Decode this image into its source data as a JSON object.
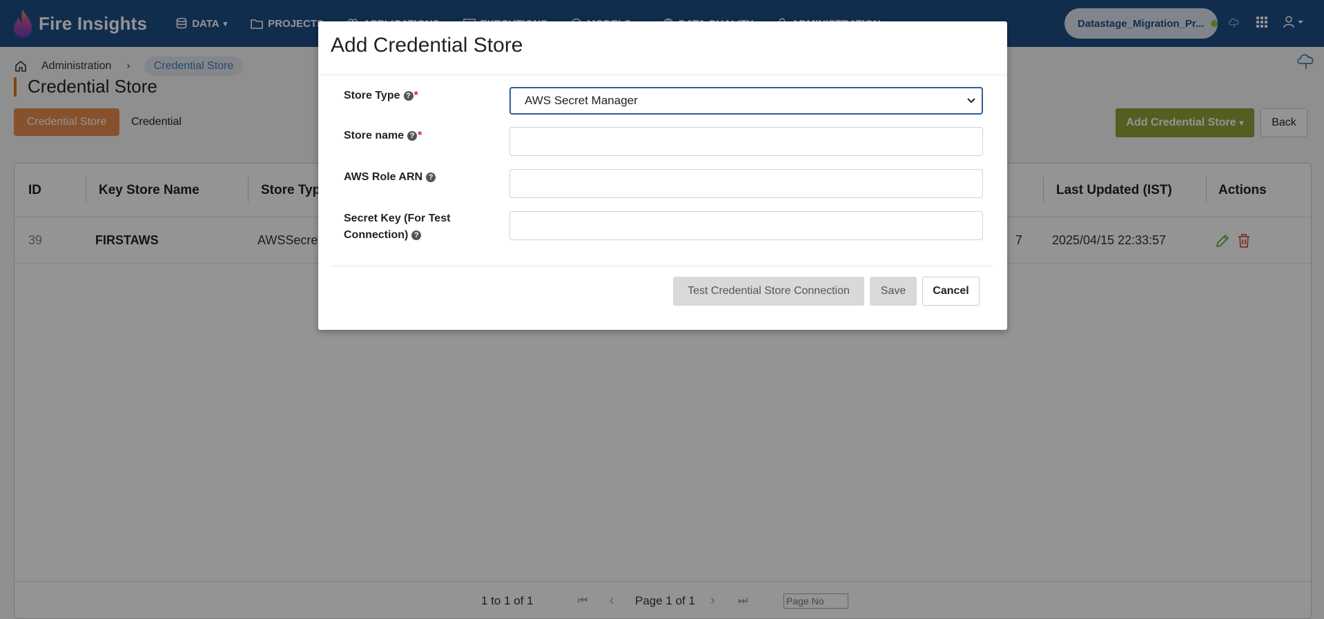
{
  "app": {
    "name": "Fire Insights",
    "nav": [
      {
        "label": "DATA",
        "icon": "database-icon",
        "caret": true
      },
      {
        "label": "PROJECTS",
        "icon": "folder-icon",
        "caret": false
      },
      {
        "label": "APPLICATIONS",
        "icon": "apps-icon",
        "caret": false
      },
      {
        "label": "EXECUTIONS",
        "icon": "executions-icon",
        "caret": false
      },
      {
        "label": "MODELS",
        "icon": "models-icon",
        "caret": true
      },
      {
        "label": "DATA QUALITY",
        "icon": "globe-icon",
        "caret": false
      },
      {
        "label": "ADMINISTRATION",
        "icon": "bell-icon",
        "caret": false
      }
    ],
    "project": "Datastage_Migration_Pr...",
    "caret": "▾"
  },
  "breadcrumb": {
    "parent": "Administration",
    "separator": "›",
    "current": "Credential Store"
  },
  "page": {
    "title": "Credential Store",
    "tabs": [
      "Credential Store",
      "Credential"
    ],
    "add_button": "Add Credential Store",
    "back_button": "Back"
  },
  "grid": {
    "columns": [
      "ID",
      "Key Store Name",
      "Store Type",
      "Last Updated (IST)",
      "Actions"
    ],
    "rows": [
      {
        "id": "39",
        "name": "FIRSTAWS",
        "type": "AWSSecret",
        "updated": "2025/04/15 22:33:57",
        "hidden_fragment": "7"
      }
    ],
    "footer": {
      "range": "1 to 1 of 1",
      "page": "Page 1 of 1",
      "page_input_placeholder": "Page No",
      "first": "⏮",
      "prev": "‹",
      "next": "›",
      "last": "⏭"
    }
  },
  "modal": {
    "title": "Add Credential Store",
    "fields": {
      "store_type_label": "Store Type",
      "store_type_value": "AWS Secret Manager",
      "store_name_label": "Store name",
      "aws_role_label": "AWS Role ARN",
      "secret_key_label_1": "Secret Key (For Test",
      "secret_key_label_2": "Connection)",
      "required_mark": "*",
      "help_mark": "?"
    },
    "buttons": {
      "test": "Test Credential Store Connection",
      "save": "Save",
      "cancel": "Cancel"
    }
  },
  "colors": {
    "nav_bg": "#1e4f86",
    "tab_active": "#e98c50",
    "add_button": "#8ea43a",
    "edit_icon": "#6aa84f",
    "delete_icon": "#d9534f",
    "required": "#d9232d"
  }
}
